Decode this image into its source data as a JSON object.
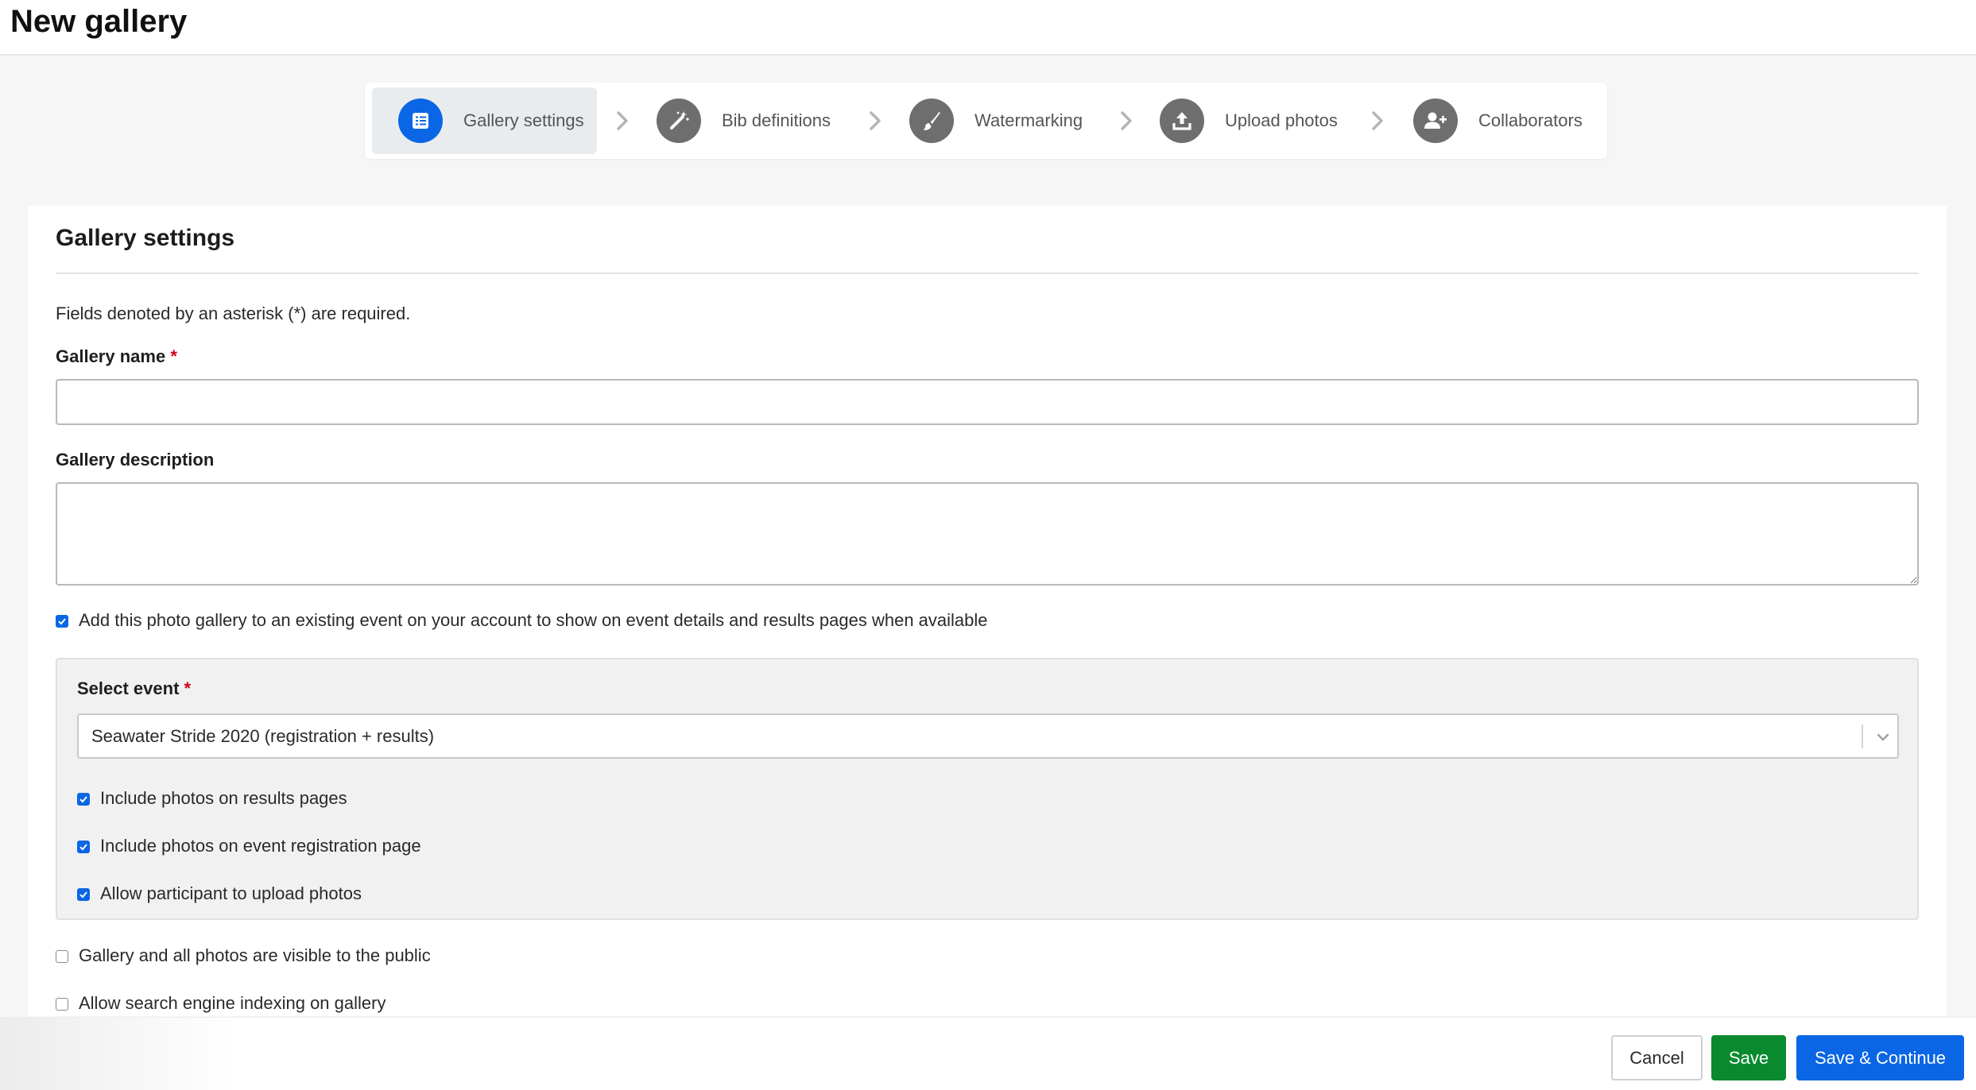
{
  "page": {
    "title": "New gallery"
  },
  "stepper": {
    "steps": [
      {
        "label": "Gallery settings",
        "icon": "list-icon",
        "active": true
      },
      {
        "label": "Bib definitions",
        "icon": "magic-wand-icon",
        "active": false
      },
      {
        "label": "Watermarking",
        "icon": "paintbrush-icon",
        "active": false
      },
      {
        "label": "Upload photos",
        "icon": "upload-icon",
        "active": false
      },
      {
        "label": "Collaborators",
        "icon": "add-user-icon",
        "active": false
      }
    ]
  },
  "form": {
    "section_title": "Gallery settings",
    "required_note": "Fields denoted by an asterisk (*) are required.",
    "gallery_name": {
      "label": "Gallery name",
      "required_mark": "*",
      "value": "",
      "placeholder": ""
    },
    "gallery_description": {
      "label": "Gallery description",
      "value": "",
      "placeholder": ""
    },
    "add_to_event": {
      "label": "Add this photo gallery to an existing event on your account to show on event details and results pages when available",
      "checked": true
    },
    "event": {
      "label": "Select event",
      "required_mark": "*",
      "selected": "Seawater Stride 2020 (registration + results)",
      "options": [
        {
          "label": "Include photos on results pages",
          "checked": true
        },
        {
          "label": "Include photos on event registration page",
          "checked": true
        },
        {
          "label": "Allow participant to upload photos",
          "checked": true
        }
      ]
    },
    "public_visible": {
      "label": "Gallery and all photos are visible to the public",
      "checked": false
    },
    "search_indexing": {
      "label": "Allow search engine indexing on gallery",
      "checked": false
    }
  },
  "footer": {
    "cancel_label": "Cancel",
    "save_label": "Save",
    "save_continue_label": "Save & Continue"
  },
  "colors": {
    "primary": "#0a66e4",
    "save_green": "#0a8a2e",
    "required": "#d0021b",
    "step_icon_inactive": "#6e6e6e"
  }
}
